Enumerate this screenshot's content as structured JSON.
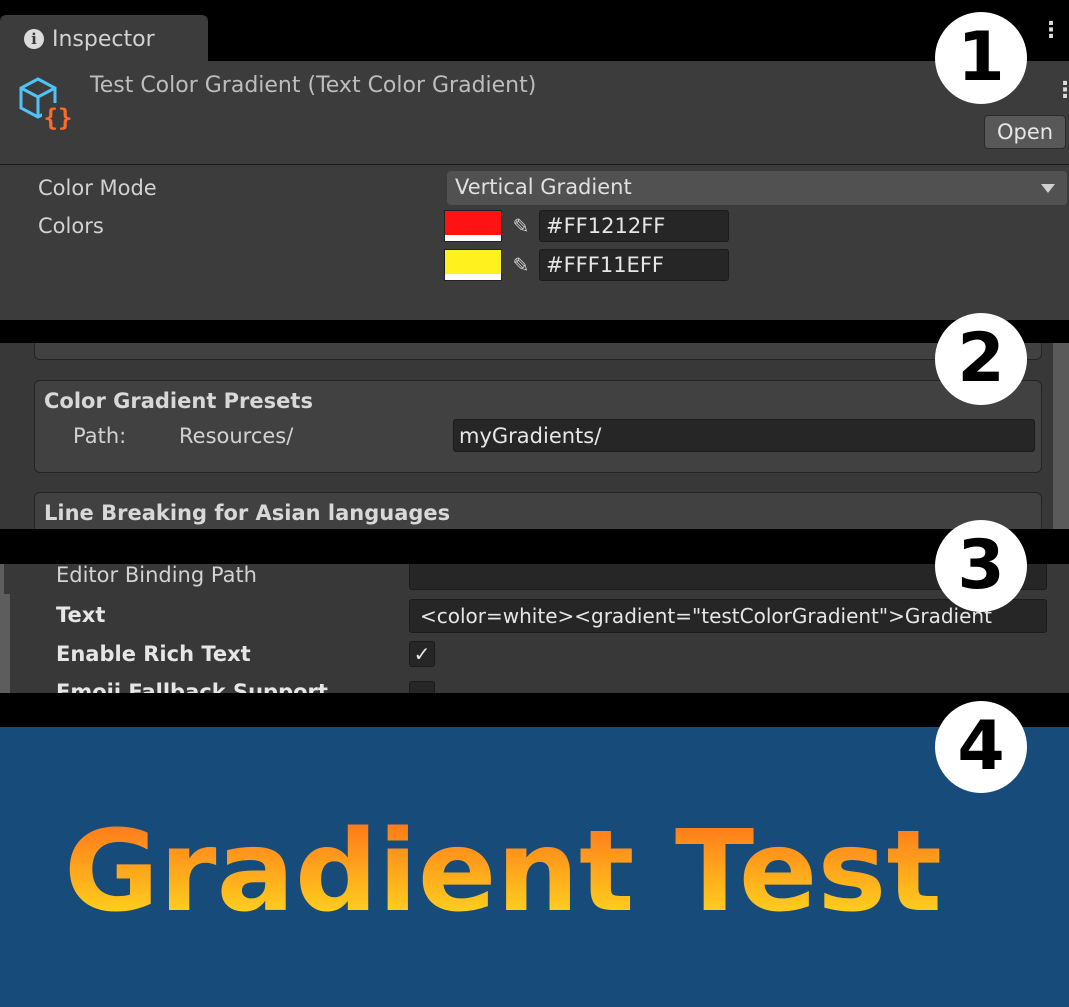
{
  "panel1": {
    "tab_label": "Inspector",
    "asset_title": "Test Color Gradient (Text Color Gradient)",
    "open_button": "Open",
    "color_mode_label": "Color Mode",
    "color_mode_value": "Vertical Gradient",
    "colors_label": "Colors",
    "colors": [
      {
        "hex": "#FF1212FF",
        "swatch": "#ff1212"
      },
      {
        "hex": "#FFF11EFF",
        "swatch": "#fff11e"
      }
    ],
    "callout_number": "1"
  },
  "panel2": {
    "presets_title": "Color Gradient Presets",
    "path_label": "Path:",
    "path_prefix": "Resources/",
    "path_value": "myGradients/",
    "line_breaking_title": "Line Breaking for Asian languages",
    "callout_number": "2"
  },
  "panel3": {
    "binding_label": "Editor Binding Path",
    "text_label": "Text",
    "text_value": "<color=white><gradient=\"testColorGradient\">Gradient",
    "rich_text_label": "Enable Rich Text",
    "emoji_label": "Emoji Fallback Support",
    "callout_number": "3"
  },
  "panel4": {
    "preview_text": "Gradient Test",
    "background_color": "#174b7a",
    "gradient_top": "#ff6a1a",
    "gradient_bottom": "#ffe61e",
    "callout_number": "4"
  }
}
